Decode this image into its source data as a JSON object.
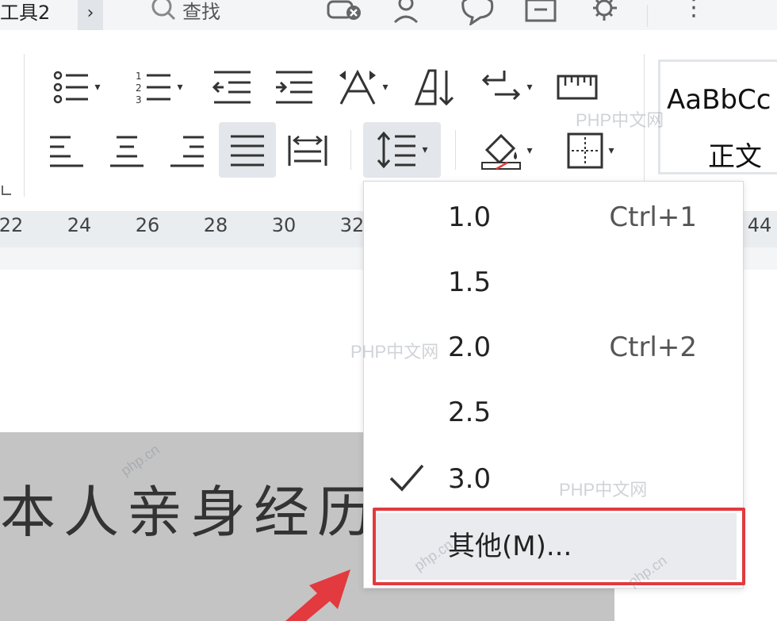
{
  "top": {
    "tab_fragment": "工具2",
    "chevron": "›",
    "search_label": "查找",
    "more": "⋮"
  },
  "style_gallery": {
    "sample": "AaBbCc",
    "name": "正文"
  },
  "ruler": {
    "numbers": [
      "22",
      "24",
      "26",
      "28",
      "30",
      "32",
      "44"
    ]
  },
  "line_spacing_menu": {
    "items": [
      {
        "label": "1.0",
        "shortcut": "Ctrl+1",
        "checked": false
      },
      {
        "label": "1.5",
        "shortcut": "",
        "checked": false
      },
      {
        "label": "2.0",
        "shortcut": "Ctrl+2",
        "checked": false
      },
      {
        "label": "2.5",
        "shortcut": "",
        "checked": false
      },
      {
        "label": "3.0",
        "shortcut": "",
        "checked": true
      }
    ],
    "other": "其他(M)..."
  },
  "document": {
    "image_text": "本人亲身经历"
  },
  "watermarks": {
    "site": "PHP中文网",
    "domain": "php.cn"
  },
  "colors": {
    "highlight": "#e23a3f",
    "menu_hover": "#e9ebee",
    "active_button": "#e3e6ea"
  }
}
